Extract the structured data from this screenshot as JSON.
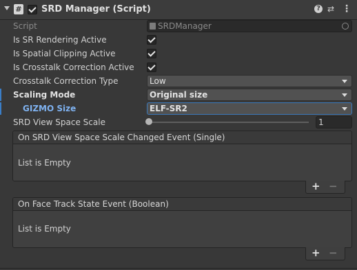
{
  "header": {
    "icon": "#",
    "title": "SRD Manager (Script)",
    "help": "?",
    "presets": "⇄",
    "menu": "⋮"
  },
  "fields": {
    "script_label": "Script",
    "script_value": "SRDManager",
    "sr_rendering_label": "Is SR Rendering Active",
    "spatial_clipping_label": "Is Spatial Clipping Active",
    "crosstalk_label": "Is Crosstalk Correction Active",
    "crosstalk_type_label": "Crosstalk Correction Type",
    "crosstalk_type_value": "Low",
    "scaling_mode_label": "Scaling Mode",
    "scaling_mode_value": "Original size",
    "gizmo_size_label": "GIZMO Size",
    "gizmo_size_value": "ELF-SR2",
    "view_scale_label": "SRD View Space Scale",
    "view_scale_value": "1"
  },
  "slider": {
    "fraction": 0
  },
  "events": [
    {
      "title": "On SRD View Space Scale Changed Event (Single)",
      "empty": "List is Empty",
      "plus": "+",
      "minus": "−"
    },
    {
      "title": "On Face Track State Event (Boolean)",
      "empty": "List is Empty",
      "plus": "+",
      "minus": "−"
    }
  ],
  "colors": {
    "accent": "#3b7ec7",
    "gizmo_label": "#7fb2f0"
  }
}
